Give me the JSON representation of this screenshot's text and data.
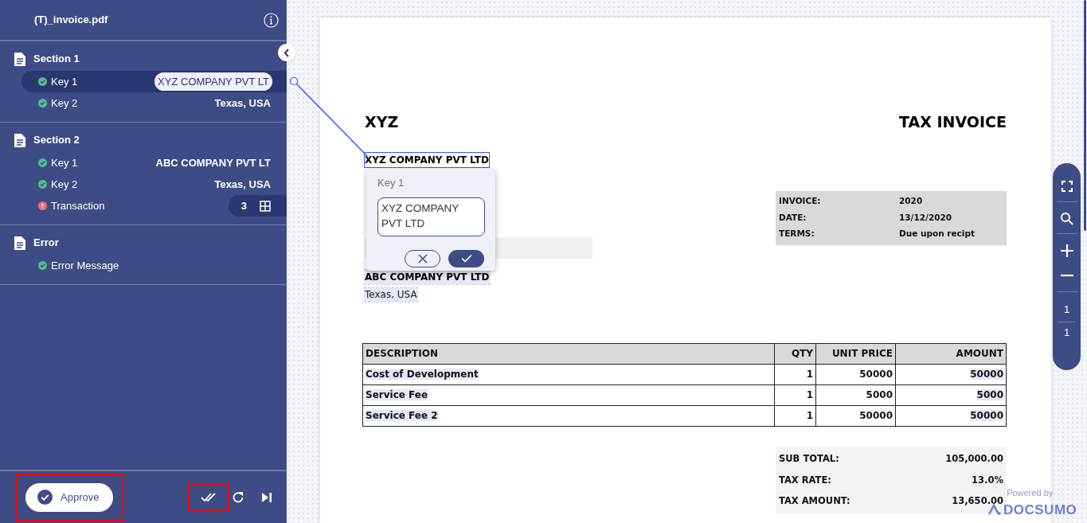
{
  "sidebar": {
    "title": "(T)_invoice.pdf",
    "sections": [
      {
        "title": "Section 1",
        "items": [
          {
            "kind": "text",
            "label": "Key 1",
            "value": "XYZ COMPANY PVT LT",
            "color": "#4fc08d",
            "selected": true
          },
          {
            "kind": "text",
            "label": "Key 2",
            "value": "Texas, USA",
            "color": "#4fc08d",
            "selected": false
          }
        ]
      },
      {
        "title": "Section 2",
        "items": [
          {
            "kind": "text",
            "label": "Key 1",
            "value": "ABC COMPANY PVT LT",
            "color": "#4fc08d",
            "selected": false
          },
          {
            "kind": "text",
            "label": "Key 2",
            "value": "Texas, USA",
            "color": "#4fc08d",
            "selected": false
          },
          {
            "kind": "table",
            "label": "Transaction",
            "value": "3",
            "color": "#e8737b",
            "selected": false
          }
        ]
      },
      {
        "title": "Error",
        "items": [
          {
            "kind": "text",
            "label": "Error Message",
            "color": "#4fc08d",
            "selected": false
          }
        ]
      }
    ],
    "footer": {
      "approve": {
        "label": "Approve",
        "highlighted": true
      },
      "approve_all": {
        "highlighted": true
      }
    }
  },
  "document": {
    "company": "XYZ",
    "title": "TAX INVOICE",
    "seller": "XYZ COMPANY PVT LTD",
    "buyer": "ABC COMPANY PVT LTD",
    "buyer_address": "Texas, USA",
    "info": [
      {
        "label": "INVOICE:",
        "value": "2020"
      },
      {
        "label": "DATE:",
        "value": "13/12/2020"
      },
      {
        "label": "TERMS:",
        "value": "Due upon recipt"
      }
    ],
    "table": {
      "columns": [
        "DESCRIPTION",
        "QTY",
        "UNIT PRICE",
        "AMOUNT"
      ],
      "rows": [
        [
          "Cost of Development",
          "1",
          "50000",
          "50000"
        ],
        [
          "Service Fee",
          "1",
          "5000",
          "5000"
        ],
        [
          "Service Fee 2",
          "1",
          "50000",
          "50000"
        ]
      ]
    },
    "totals": [
      {
        "label": "SUB TOTAL:",
        "value": "105,000.00"
      },
      {
        "label": "TAX RATE:",
        "value": "13.0%"
      },
      {
        "label": "TAX AMOUNT:",
        "value": "13,650.00"
      }
    ]
  },
  "popup": {
    "label": "Key 1",
    "value": "XYZ COMPANY PVT LTD"
  },
  "zoom_toolbar": {
    "page": "1",
    "pages": "1"
  },
  "branding": {
    "caption": "Powered by",
    "name": "DOCSUMO"
  }
}
